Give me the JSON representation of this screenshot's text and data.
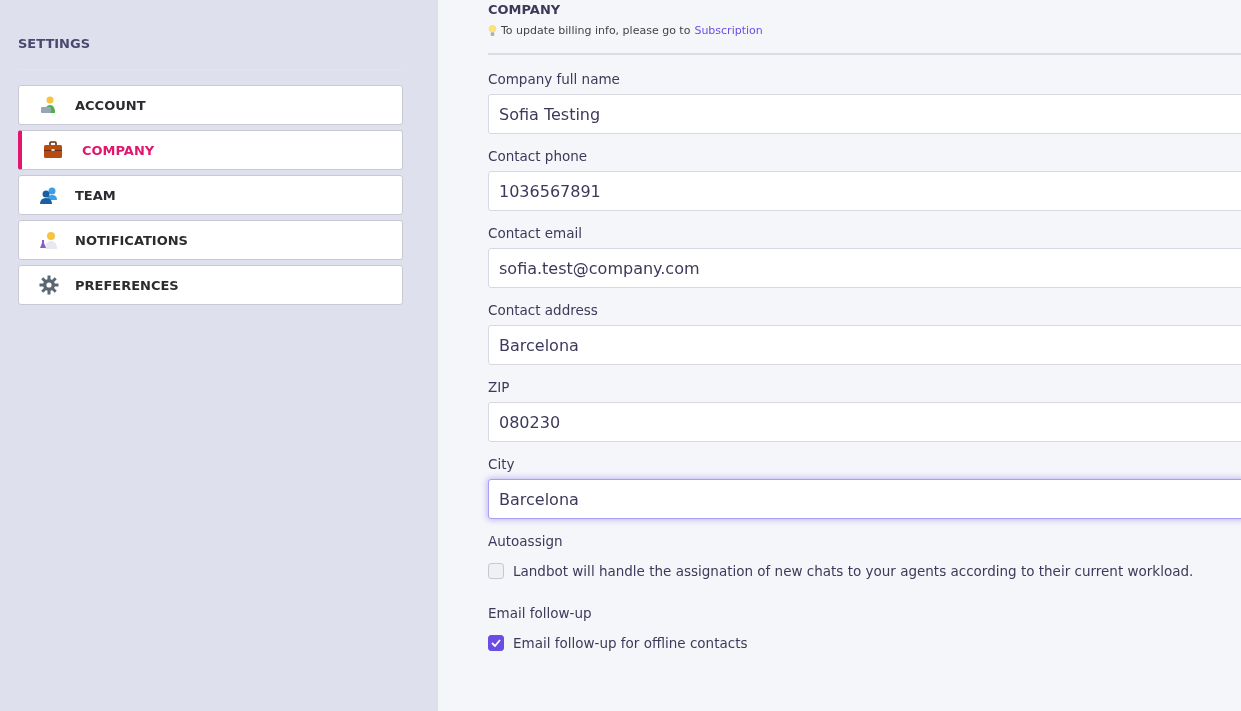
{
  "sidebar": {
    "title": "SETTINGS",
    "items": [
      {
        "label": "ACCOUNT",
        "selected": false
      },
      {
        "label": "COMPANY",
        "selected": true
      },
      {
        "label": "TEAM",
        "selected": false
      },
      {
        "label": "NOTIFICATIONS",
        "selected": false
      },
      {
        "label": "PREFERENCES",
        "selected": false
      }
    ]
  },
  "main": {
    "heading": "COMPANY",
    "hint": "To update billing info, please go to",
    "hint_link": "Subscription",
    "fields": [
      {
        "label": "Company full name",
        "value": "Sofia Testing",
        "focused": false
      },
      {
        "label": "Contact phone",
        "value": "1036567891",
        "focused": false
      },
      {
        "label": "Contact email",
        "value": "sofia.test@company.com",
        "focused": false
      },
      {
        "label": "Contact address",
        "value": "Barcelona",
        "focused": false
      },
      {
        "label": "ZIP",
        "value": "080230",
        "focused": false
      },
      {
        "label": "City",
        "value": "Barcelona",
        "focused": true
      }
    ],
    "options": [
      {
        "label": "Autoassign",
        "text": "Landbot will handle the assignation of new chats to your agents according to their current workload.",
        "checked": false
      },
      {
        "label": "Email follow-up",
        "text": "Email follow-up for offline contacts",
        "checked": true
      }
    ]
  }
}
